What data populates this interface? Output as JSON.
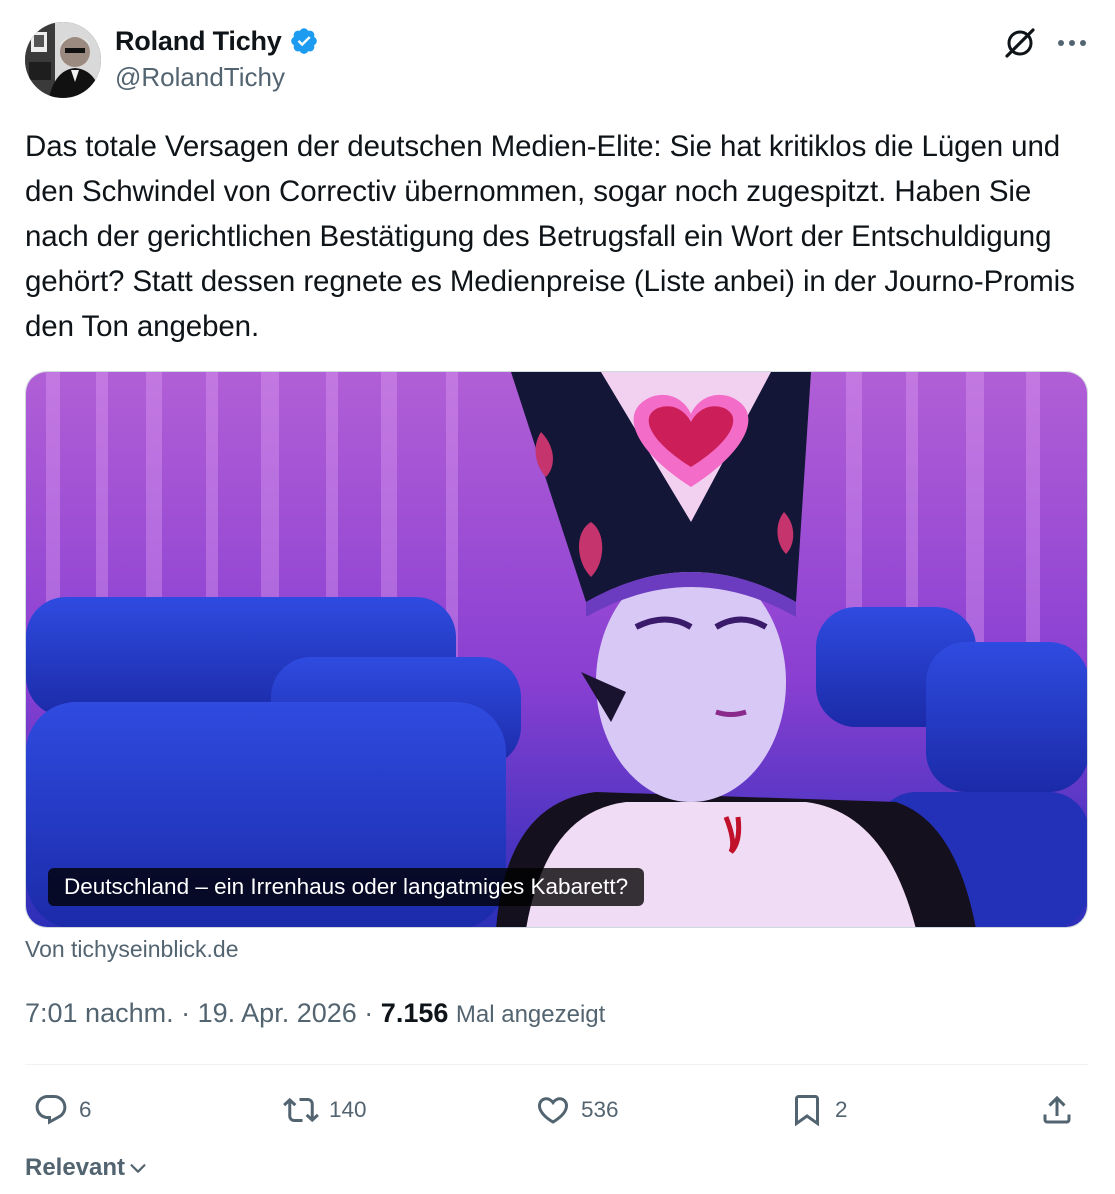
{
  "post": {
    "author": {
      "display_name": "Roland Tichy",
      "handle": "@RolandTichy",
      "verified": true,
      "avatar_icon": "profile-photo"
    },
    "text": "Das totale Versagen der deutschen Medien-Elite: Sie hat kritiklos die Lügen und den Schwindel von Correctiv übernommen, sogar noch zugespitzt. Haben Sie nach der gerichtlichen Bestätigung des Betrugsfall ein Wort der Entschuldigung gehört? Statt dessen regnete es Medienpreise (Liste anbei) in der Journo-Promis den Ton angeben.",
    "card": {
      "caption": "Deutschland – ein Irrenhaus oder langatmiges Kabarett?",
      "source": "Von tichyseinblick.de"
    },
    "meta": {
      "time": "7:01 nachm.",
      "separator": "·",
      "date": "19. Apr. 2026",
      "views_count": "7.156",
      "views_label": "Mal angezeigt"
    },
    "actions": {
      "replies": "6",
      "reposts": "140",
      "likes": "536",
      "bookmarks": "2"
    },
    "replies_sort": "Relevant"
  },
  "colors": {
    "text_primary": "#0f1419",
    "text_secondary": "#536471",
    "verified_blue": "#1d9bf0",
    "divider": "#eff3f4"
  },
  "icons": [
    "verified-badge-icon",
    "grok-icon",
    "more-icon",
    "reply-icon",
    "repost-icon",
    "like-icon",
    "bookmark-icon",
    "share-icon",
    "chevron-down-icon"
  ]
}
